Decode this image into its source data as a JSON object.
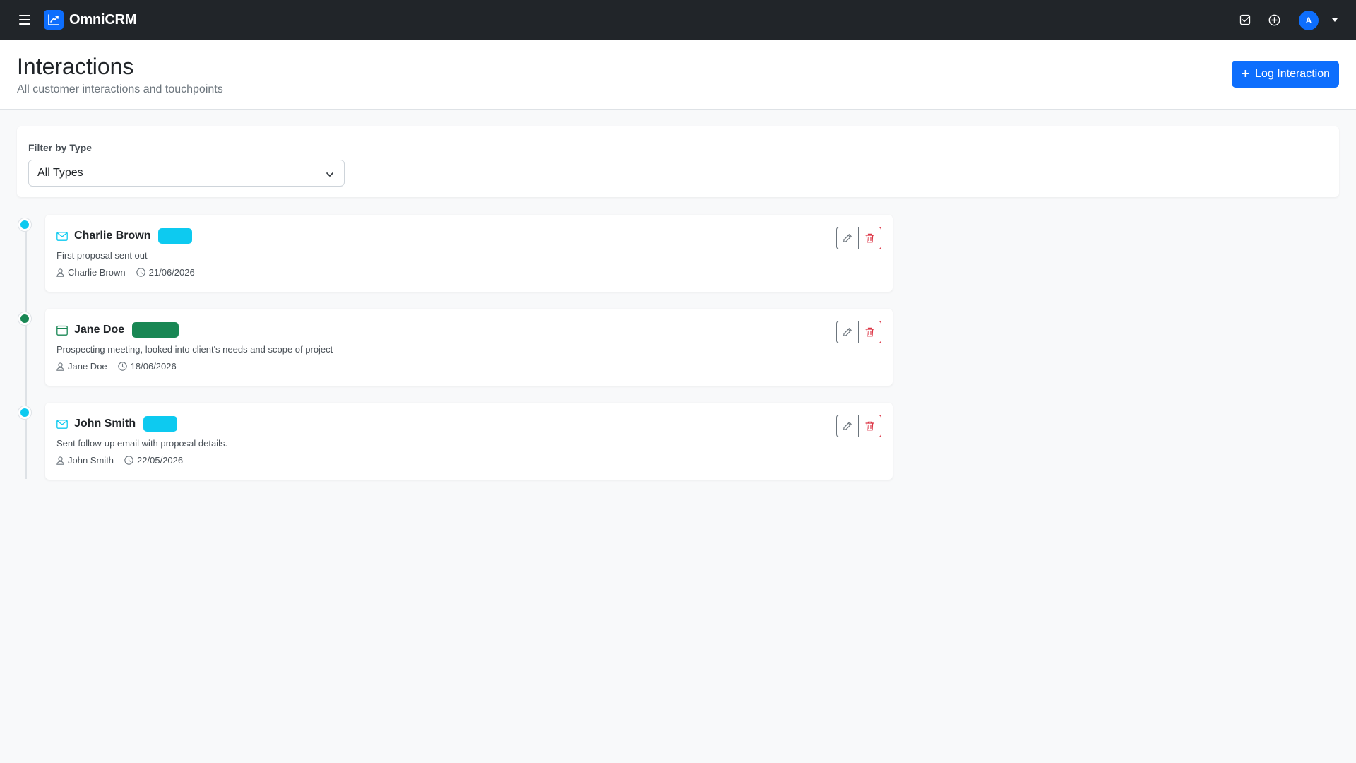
{
  "app": {
    "brand": "OmniCRM",
    "user_initial": "A"
  },
  "colors": {
    "primary": "#0d6efd",
    "email": "#0dcaf0",
    "meeting": "#198754",
    "danger": "#dc3545",
    "navbar": "#212529"
  },
  "header": {
    "title": "Interactions",
    "subtitle": "All customer interactions and touchpoints",
    "log_button": "Log Interaction"
  },
  "filter": {
    "label": "Filter by Type",
    "selected": "All Types"
  },
  "interactions": [
    {
      "name": "Charlie Brown",
      "type_icon": "envelope-icon",
      "badge_color": "#0dcaf0",
      "description": "First proposal sent out",
      "contact": "Charlie Brown",
      "date": "21/06/2026"
    },
    {
      "name": "Jane Doe",
      "type_icon": "calendar-icon",
      "badge_color": "#198754",
      "description": "Prospecting meeting, looked into client's needs and scope of project",
      "contact": "Jane Doe",
      "date": "18/06/2026"
    },
    {
      "name": "John Smith",
      "type_icon": "envelope-icon",
      "badge_color": "#0dcaf0",
      "description": "Sent follow-up email with proposal details.",
      "contact": "John Smith",
      "date": "22/05/2026"
    }
  ]
}
